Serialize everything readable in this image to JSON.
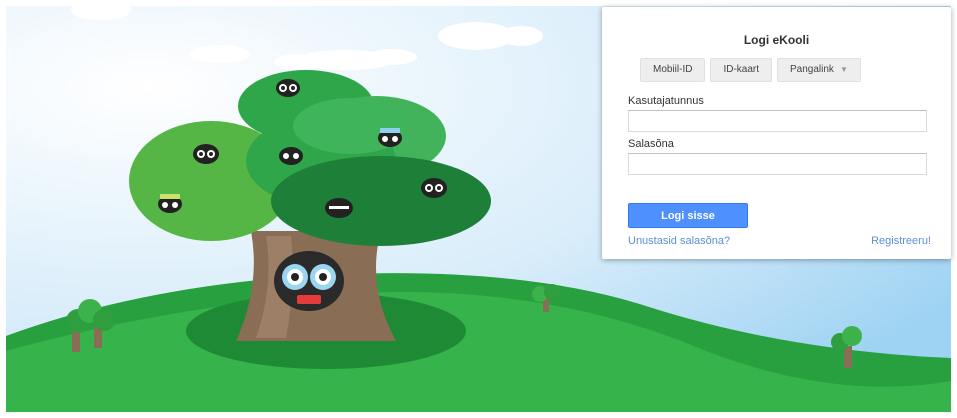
{
  "login": {
    "title": "Logi eKooli",
    "tabs": [
      "Mobiil-ID",
      "ID-kaart",
      "Pangalink"
    ],
    "username_label": "Kasutajatunnus",
    "username_value": "",
    "password_label": "Salasõna",
    "password_value": "",
    "submit_label": "Logi sisse",
    "forgot_link": "Unustasid salasõna?",
    "register_link": "Registreeru!"
  },
  "colors": {
    "sky": "#dbeefa",
    "hill_dark": "#1f8a35",
    "hill_light": "#36b34a",
    "trunk": "#8a6d55",
    "button": "#4d90fe",
    "link": "#5b8fd6"
  }
}
